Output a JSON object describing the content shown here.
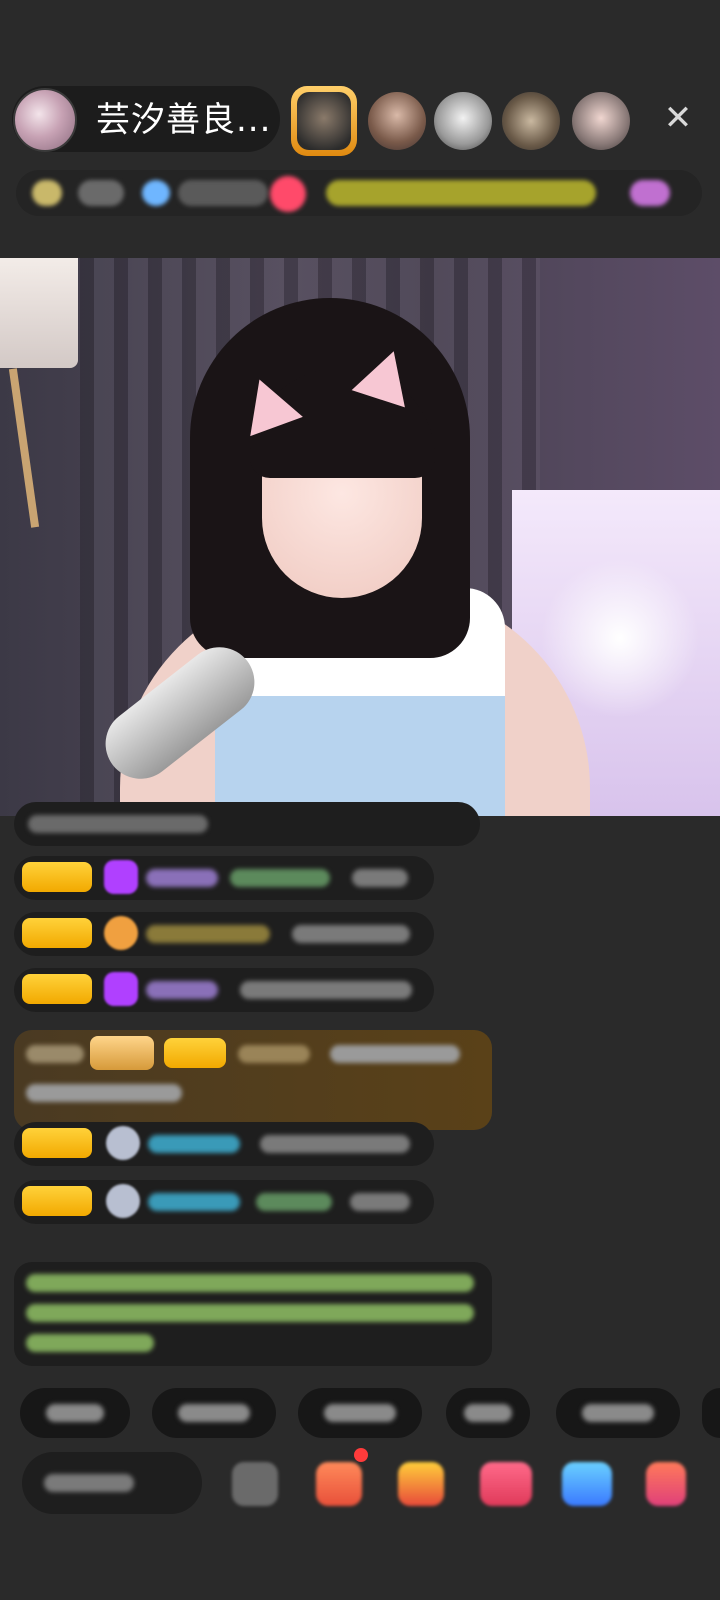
{
  "header": {
    "host_name": "芸汐善良...",
    "close_icon": "close-icon",
    "close_glyph": "✕"
  },
  "colors": {
    "background": "#2a2a2a",
    "badge_gold": "#f2a900",
    "gem_purple": "#b040ff",
    "highlight_brown": "#5a4118",
    "notice_green": "#a8d84a"
  }
}
